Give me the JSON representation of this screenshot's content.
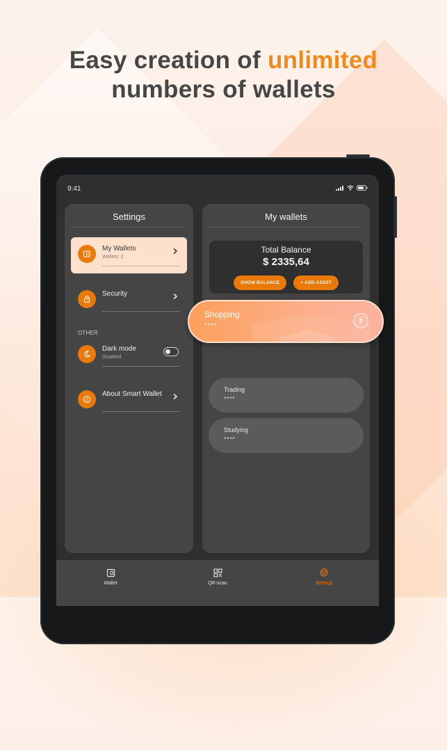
{
  "headline": {
    "prefix": "Easy creation of ",
    "accent": "unlimited",
    "line2": "numbers of wallets"
  },
  "colors": {
    "accent": "#e8790a",
    "headline_accent": "#f08a1a",
    "panel": "#454545",
    "screen": "#2f2f2f"
  },
  "status_bar": {
    "time": "9:41",
    "icons": [
      "cellular-signal-icon",
      "wifi-icon",
      "battery-icon"
    ]
  },
  "settings": {
    "title": "Settings",
    "items": [
      {
        "label": "My Wallets",
        "sub": "Wallets: 2",
        "icon": "wallet-icon",
        "active": true
      },
      {
        "label": "Security",
        "icon": "lock-icon"
      }
    ],
    "section_other": "OTHER",
    "other_items": [
      {
        "label": "Dark mode",
        "sub": "Disabled",
        "icon": "moon-icon",
        "toggle_on": false
      },
      {
        "label": "About Smart Wallet",
        "icon": "info-icon"
      }
    ]
  },
  "wallets_panel": {
    "title": "My wallets",
    "balance": {
      "title": "Total Balance",
      "value": "$ 2335,64",
      "show_button": "SHOW BALANCE",
      "add_button": "+ ADD ASSET"
    },
    "wallets": [
      {
        "name": "Shopping",
        "mask": "****",
        "highlighted": true
      },
      {
        "name": "Trading",
        "mask": "****"
      },
      {
        "name": "Studying",
        "mask": "****"
      }
    ]
  },
  "tabbar": {
    "tabs": [
      {
        "label": "Wallet",
        "icon": "wallet-icon"
      },
      {
        "label": "QR-scan",
        "icon": "qr-code-icon"
      },
      {
        "label": "Settings",
        "icon": "gear-icon",
        "active": true
      }
    ]
  }
}
